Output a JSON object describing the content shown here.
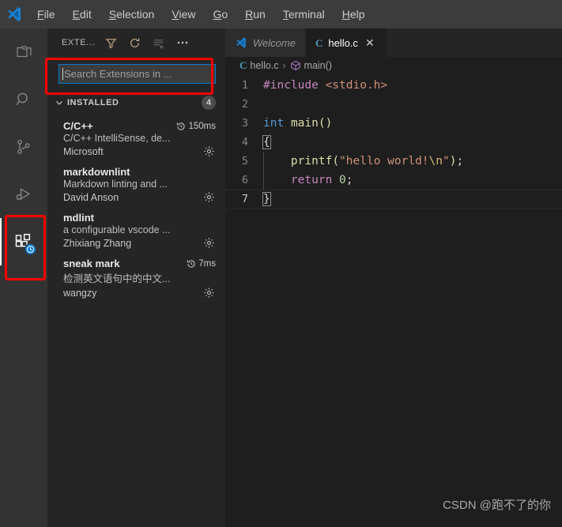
{
  "window": {
    "logo_icon": "vscode-logo-icon"
  },
  "menu": {
    "items": [
      {
        "label": "File",
        "mnemonic": "F"
      },
      {
        "label": "Edit",
        "mnemonic": "E"
      },
      {
        "label": "Selection",
        "mnemonic": "S"
      },
      {
        "label": "View",
        "mnemonic": "V"
      },
      {
        "label": "Go",
        "mnemonic": "G"
      },
      {
        "label": "Run",
        "mnemonic": "R"
      },
      {
        "label": "Terminal",
        "mnemonic": "T"
      },
      {
        "label": "Help",
        "mnemonic": "H"
      }
    ]
  },
  "activity_bar": {
    "items": [
      {
        "name": "explorer",
        "icon": "files-icon",
        "active": false
      },
      {
        "name": "search",
        "icon": "search-icon",
        "active": false
      },
      {
        "name": "source-control",
        "icon": "source-control-icon",
        "active": false
      },
      {
        "name": "run-and-debug",
        "icon": "run-debug-icon",
        "active": false
      },
      {
        "name": "extensions",
        "icon": "extensions-icon",
        "active": true,
        "badge": "clock-badge"
      }
    ]
  },
  "sidebar": {
    "title": "EXTE...",
    "actions": [
      {
        "name": "filter",
        "icon": "filter-icon"
      },
      {
        "name": "refresh",
        "icon": "refresh-icon"
      },
      {
        "name": "clear-list",
        "icon": "clear-list-icon"
      },
      {
        "name": "more",
        "icon": "more-actions-icon"
      }
    ],
    "search": {
      "placeholder": "Search Extensions in ...",
      "value": ""
    },
    "section": {
      "label": "INSTALLED",
      "count": "4",
      "expanded": true
    },
    "extensions": [
      {
        "name": "C/C++",
        "activation_time": "150ms",
        "description": "C/C++ IntelliSense, de...",
        "publisher": "Microsoft"
      },
      {
        "name": "markdownlint",
        "activation_time": "",
        "description": "Markdown linting and ...",
        "publisher": "David Anson"
      },
      {
        "name": "mdlint",
        "activation_time": "",
        "description": "a configurable vscode ...",
        "publisher": "Zhixiang Zhang"
      },
      {
        "name": "sneak mark",
        "activation_time": "7ms",
        "description": "检测英文语句中的中文...",
        "publisher": "wangzy"
      }
    ]
  },
  "editor": {
    "tabs": [
      {
        "label": "Welcome",
        "icon": "vscode-logo-icon",
        "active": false,
        "preview": true,
        "closable": false
      },
      {
        "label": "hello.c",
        "icon": "c-file-icon",
        "active": true,
        "preview": false,
        "closable": true,
        "close_label": "✕"
      }
    ],
    "breadcrumb": {
      "file": "hello.c",
      "file_icon": "c-file-icon",
      "separator": "›",
      "symbol": "main()",
      "symbol_icon": "symbol-method-icon"
    },
    "lines": [
      {
        "number": "1",
        "text": "#include <stdio.h>",
        "current": false
      },
      {
        "number": "2",
        "text": "",
        "current": false
      },
      {
        "number": "3",
        "text": "int main()",
        "current": false
      },
      {
        "number": "4",
        "text": "{",
        "current": false
      },
      {
        "number": "5",
        "text": "    printf(\"hello world!\\n\");",
        "current": false
      },
      {
        "number": "6",
        "text": "    return 0;",
        "current": false
      },
      {
        "number": "7",
        "text": "}",
        "current": true
      }
    ]
  },
  "annotations": [
    {
      "name": "extensions-icon-highlight",
      "color": "#fe0000"
    },
    {
      "name": "search-box-highlight",
      "color": "#fe0000"
    }
  ],
  "watermark": {
    "text": "CSDN @跑不了的你"
  }
}
